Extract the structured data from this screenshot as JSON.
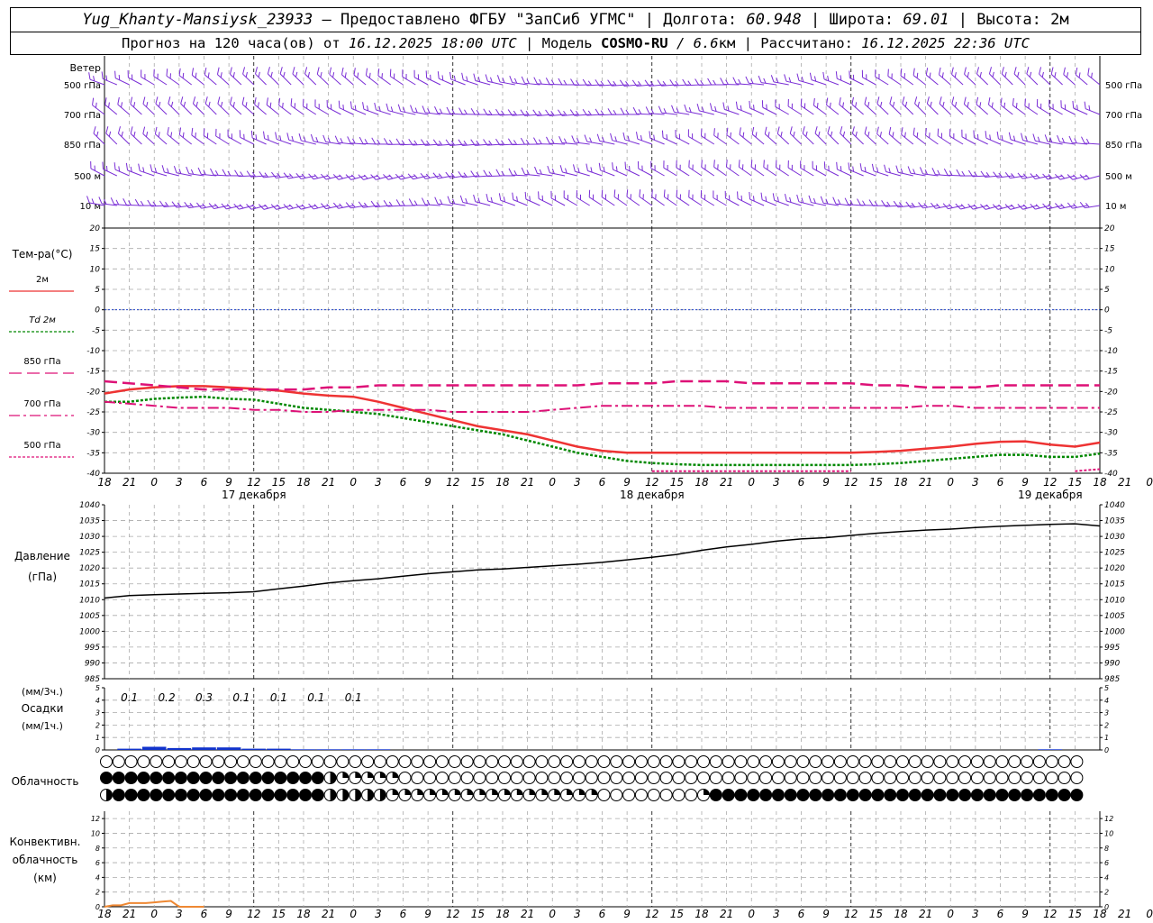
{
  "header": {
    "station": "Yug_Khanty-Mansiysk_23933",
    "provided": " — Предоставлено ФГБУ \"ЗапСиб УГМС\" ",
    "lon_label": "| Долгота: ",
    "lon": "60.948",
    "lat_label": " | Широта: ",
    "lat": "69.01",
    "alt_label": " | Высота: ",
    "alt": "2м",
    "forecast_label": "Прогноз на 120 часа(ов) от ",
    "forecast_start": "16.12.2025 18:00 UTC",
    "model_label": " | Модель ",
    "model": "COSMO-RU",
    "resolution": " / 6.6",
    "resolution_unit": "км",
    "computed_label": " | Рассчитано: ",
    "computed": "16.12.2025 22:36 UTC"
  },
  "colors": {
    "t2m": "#ee3333",
    "td2m": "#008800",
    "t850": "#dd1177",
    "t700": "#dd1177",
    "t500": "#dd1177",
    "wind": "#7a2ed6",
    "zero_line": "#2244cc",
    "pressure": "#000000",
    "precip": "#1133cc",
    "convective": "#ee8833",
    "grid": "#aaaaaa"
  },
  "chart_data": [
    {
      "type": "wind-barbs",
      "title": "Ветер",
      "levels": [
        "500 гПа",
        "700 гПа",
        "850 гПа",
        "500 м",
        "10  м"
      ]
    },
    {
      "type": "line",
      "ylabel": "Тем-ра(°C)",
      "ylim": [
        -40,
        20
      ],
      "yticks": [
        -40,
        -35,
        -30,
        -25,
        -20,
        -15,
        -10,
        -5,
        0,
        5,
        10,
        15,
        20
      ],
      "x_hours": [
        0,
        3,
        6,
        9,
        12,
        15,
        18,
        21,
        24,
        27,
        30,
        33,
        36,
        39,
        42,
        45,
        48,
        51,
        54,
        57,
        60,
        63,
        66,
        69,
        72,
        75,
        78,
        81,
        84,
        87,
        90,
        93,
        96,
        99,
        102,
        105,
        108,
        111,
        114,
        117,
        120
      ],
      "series": [
        {
          "name": "2м",
          "values": [
            -20.5,
            -19.5,
            -19,
            -18.7,
            -18.7,
            -19,
            -19.3,
            -19.8,
            -20.5,
            -21,
            -21.3,
            -22.5,
            -24,
            -25.5,
            -27,
            -28.5,
            -29.5,
            -30.5,
            -32,
            -33.5,
            -34.5,
            -35,
            -35,
            -35,
            -35,
            -35,
            -35,
            -35,
            -35,
            -35,
            -35,
            -34.8,
            -34.5,
            -34,
            -33.5,
            -32.8,
            -32.3,
            -32.2,
            -33,
            -33.5,
            -32.5
          ]
        },
        {
          "name": "Td 2м",
          "values": [
            -22.5,
            -22.5,
            -21.8,
            -21.5,
            -21.3,
            -21.8,
            -22,
            -23,
            -24,
            -24.5,
            -25,
            -25.5,
            -26.5,
            -27.5,
            -28.5,
            -29.5,
            -30.5,
            -32,
            -33.5,
            -35,
            -36,
            -37,
            -37.5,
            -37.8,
            -38,
            -38,
            -38,
            -38,
            -38,
            -38,
            -38,
            -37.8,
            -37.5,
            -37,
            -36.5,
            -36,
            -35.5,
            -35.5,
            -36,
            -36,
            -35.2
          ]
        },
        {
          "name": "850 гПа",
          "values": [
            -17.5,
            -18,
            -18.5,
            -19,
            -19.5,
            -19.5,
            -19.5,
            -19.5,
            -19.5,
            -19,
            -19,
            -18.5,
            -18.5,
            -18.5,
            -18.5,
            -18.5,
            -18.5,
            -18.5,
            -18.5,
            -18.5,
            -18,
            -18,
            -18,
            -17.5,
            -17.5,
            -17.5,
            -18,
            -18,
            -18,
            -18,
            -18,
            -18.5,
            -18.5,
            -19,
            -19,
            -19,
            -18.5,
            -18.5,
            -18.5,
            -18.5,
            -18.5
          ]
        },
        {
          "name": "700 гПа",
          "values": [
            -22.5,
            -23,
            -23.5,
            -24,
            -24,
            -24,
            -24.5,
            -24.5,
            -25,
            -25,
            -24.5,
            -24.5,
            -24.5,
            -24.5,
            -25,
            -25,
            -25,
            -25,
            -24.5,
            -24,
            -23.5,
            -23.5,
            -23.5,
            -23.5,
            -23.5,
            -24,
            -24,
            -24,
            -24,
            -24,
            -24,
            -24,
            -24,
            -23.5,
            -23.5,
            -24,
            -24,
            -24,
            -24,
            -24,
            -24
          ]
        },
        {
          "name": "500 гПа",
          "values": [
            -40,
            null,
            null,
            null,
            null,
            null,
            null,
            null,
            -40,
            null,
            null,
            null,
            null,
            null,
            null,
            null,
            null,
            null,
            null,
            null,
            null,
            null,
            -39.5,
            -39.5,
            -39.5,
            -39.5,
            -39.5,
            -39.5,
            -39.5,
            -39.5,
            -39.5,
            null,
            null,
            null,
            null,
            null,
            null,
            null,
            null,
            -39.5,
            -39
          ]
        }
      ]
    },
    {
      "type": "line",
      "ylabel": "Давление",
      "ylabel2": "(гПа)",
      "ylim": [
        985,
        1040
      ],
      "yticks": [
        985,
        990,
        995,
        1000,
        1005,
        1010,
        1015,
        1020,
        1025,
        1030,
        1035,
        1040
      ],
      "x_hours": [
        0,
        3,
        6,
        9,
        12,
        15,
        18,
        21,
        24,
        27,
        30,
        33,
        36,
        39,
        42,
        45,
        48,
        51,
        54,
        57,
        60,
        63,
        66,
        69,
        72,
        75,
        78,
        81,
        84,
        87,
        90,
        93,
        96,
        99,
        102,
        105,
        108,
        111,
        114,
        117,
        120
      ],
      "values": [
        1010.5,
        1011.3,
        1011.6,
        1011.8,
        1012,
        1012.2,
        1012.5,
        1013.4,
        1014.3,
        1015.3,
        1016,
        1016.6,
        1017.4,
        1018.2,
        1018.8,
        1019.4,
        1019.7,
        1020.2,
        1020.7,
        1021.2,
        1021.8,
        1022.6,
        1023.4,
        1024.3,
        1025.6,
        1026.7,
        1027.5,
        1028.5,
        1029.2,
        1029.6,
        1030.3,
        1031,
        1031.5,
        1032,
        1032.3,
        1032.8,
        1033.2,
        1033.5,
        1033.8,
        1034,
        1033.3
      ]
    },
    {
      "type": "bar",
      "ylabel_top": "(мм/3ч.)",
      "ylabel": "Осадки",
      "ylabel_bottom": "(мм/1ч.)",
      "ylim": [
        0,
        5
      ],
      "yticks": [
        0,
        1,
        2,
        3,
        4,
        5
      ],
      "labels_3h": [
        "0.1",
        "0.2",
        "0.3",
        "0.1",
        "0.1",
        "0.1",
        "0.1"
      ],
      "x_hours": [
        3,
        6,
        9,
        12,
        15,
        18,
        21,
        24,
        27,
        30,
        33,
        36,
        39,
        42,
        45,
        48,
        51,
        54,
        57,
        60,
        63,
        66,
        69,
        72,
        75,
        78,
        81,
        84,
        87,
        90,
        93,
        96,
        99,
        102,
        105,
        108,
        111,
        114,
        117
      ],
      "values": [
        0.1,
        0.25,
        0.15,
        0.2,
        0.2,
        0.1,
        0.1,
        0.05,
        0.05,
        0.05,
        0.05,
        0,
        0,
        0,
        0,
        0,
        0,
        0,
        0,
        0,
        0,
        0,
        0,
        0,
        0,
        0,
        0,
        0,
        0,
        0,
        0,
        0,
        0,
        0,
        0,
        0,
        0,
        0.05,
        0
      ]
    },
    {
      "type": "cloud-symbols",
      "title": "Облачность",
      "rows": [
        "0000000000000000000000000000000000000000000000000000000000000000000000000000000",
        "8888888888888888884222220000000000000000000000000000000000000000000000000000000",
        "4888888888888888884444422222222222222222000000002888888888888888888888888888888"
      ]
    },
    {
      "type": "bar",
      "ylabel": "Конвективн.",
      "ylabel2": "облачность",
      "ylabel3": "(км)",
      "ylim": [
        0,
        13
      ],
      "yticks": [
        0,
        2,
        4,
        6,
        8,
        10,
        12
      ],
      "values": [
        0,
        0.2,
        0.2,
        0.5,
        0.5,
        0.5,
        0.6,
        0.7,
        0.8,
        0,
        0,
        0,
        0
      ]
    }
  ],
  "x_axis": {
    "hour_labels": [
      "18",
      "21",
      "0",
      "3",
      "6",
      "9",
      "12",
      "15",
      "18",
      "21",
      "0",
      "3",
      "6",
      "9",
      "12",
      "15",
      "18",
      "21",
      "0",
      "3",
      "6",
      "9",
      "12",
      "15",
      "18",
      "21",
      "0",
      "3",
      "6",
      "9",
      "12",
      "15",
      "18",
      "21",
      "0",
      "3",
      "6",
      "9",
      "12",
      "15",
      "18",
      "21",
      "0"
    ],
    "day_labels": [
      "17 декабря",
      "18 декабря",
      "19 декабря"
    ]
  }
}
